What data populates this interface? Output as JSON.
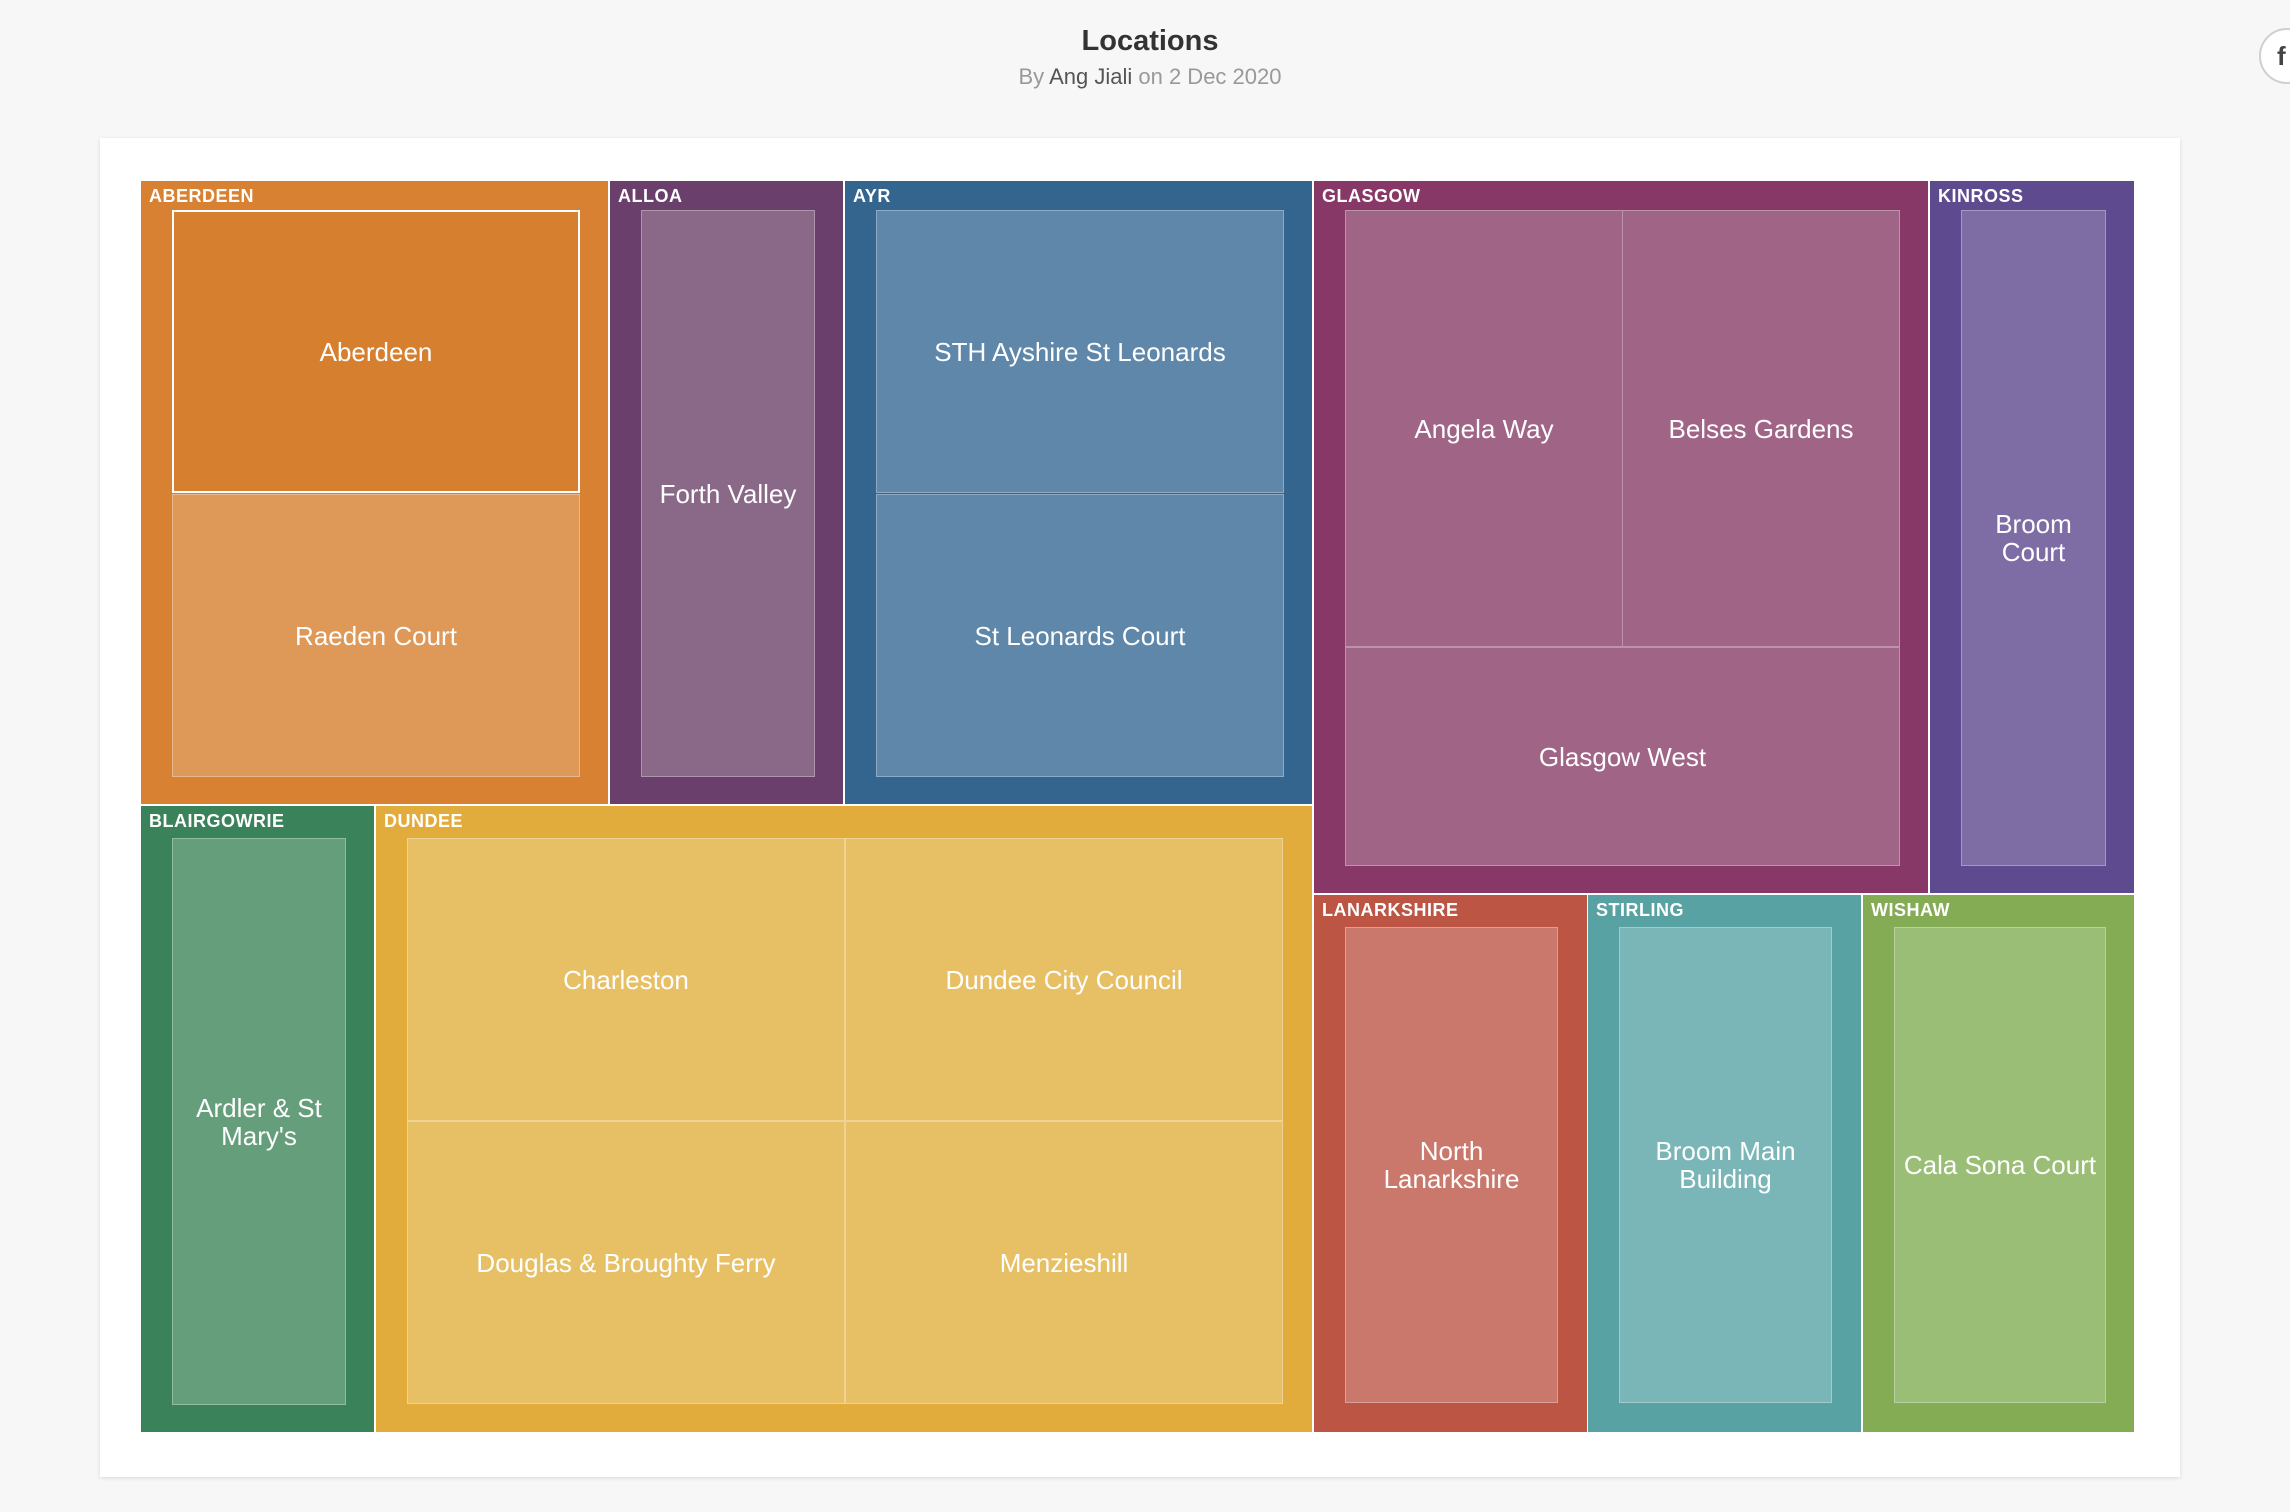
{
  "header": {
    "title": "Locations",
    "byline_prefix": "By",
    "author": "Ang Jiali",
    "byline_suffix": "on 2 Dec 2020"
  },
  "share": {
    "icon": "facebook-icon",
    "glyph": "f"
  },
  "chart_data": {
    "type": "treemap",
    "title": "Locations",
    "groups": [
      {
        "name": "ABERDEEN",
        "color": "#d88132",
        "leaf_color": "#d67f2f",
        "items": [
          {
            "name": "Aberdeen",
            "selected": true
          },
          {
            "name": "Raeden Court",
            "color": "#de9858"
          }
        ]
      },
      {
        "name": "ALLOA",
        "color": "#6a3f6c",
        "leaf_color": "#8a6888",
        "items": [
          {
            "name": "Forth Valley"
          }
        ]
      },
      {
        "name": "AYR",
        "color": "#33658e",
        "leaf_color": "#5f87aa",
        "items": [
          {
            "name": "STH Ayshire St Leonards"
          },
          {
            "name": "St Leonards Court"
          }
        ]
      },
      {
        "name": "GLASGOW",
        "color": "#883866",
        "leaf_color": "#a06586",
        "items": [
          {
            "name": "Angela Way"
          },
          {
            "name": "Belses Gardens"
          },
          {
            "name": "Glasgow West"
          }
        ]
      },
      {
        "name": "KINROSS",
        "color": "#5e4a8f",
        "leaf_color": "#7e6ca5",
        "items": [
          {
            "name": "Broom Court"
          }
        ]
      },
      {
        "name": "BLAIRGOWRIE",
        "color": "#3a825a",
        "leaf_color": "#659e7a",
        "items": [
          {
            "name": "Ardler & St Mary's"
          }
        ]
      },
      {
        "name": "DUNDEE",
        "color": "#e2ac3c",
        "leaf_color": "#e7c066",
        "items": [
          {
            "name": "Charleston"
          },
          {
            "name": "Dundee City Council"
          },
          {
            "name": "Douglas & Broughty Ferry"
          },
          {
            "name": "Menzieshill"
          }
        ]
      },
      {
        "name": "LANARKSHIRE",
        "color": "#bc5543",
        "leaf_color": "#cb786c",
        "items": [
          {
            "name": "North Lanarkshire"
          }
        ]
      },
      {
        "name": "STIRLING",
        "color": "#59a2a3",
        "leaf_color": "#7ab6b7",
        "items": [
          {
            "name": "Broom Main Building"
          }
        ]
      },
      {
        "name": "WISHAW",
        "color": "#83ac54",
        "leaf_color": "#9bbe77",
        "items": [
          {
            "name": "Cala Sona Court"
          }
        ]
      }
    ]
  }
}
